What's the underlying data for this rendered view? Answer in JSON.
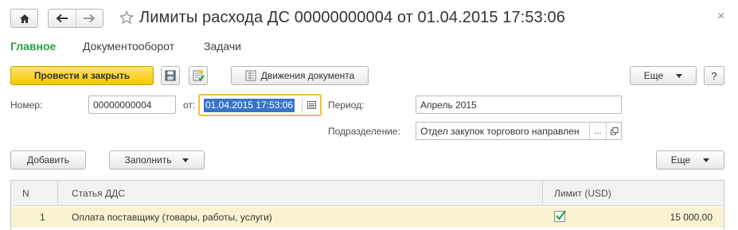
{
  "window": {
    "title": "Лимиты расхода ДС 00000000004 от 01.04.2015 17:53:06",
    "close_symbol": "×"
  },
  "tabs": [
    {
      "label": "Главное",
      "active": true
    },
    {
      "label": "Документооборот",
      "active": false
    },
    {
      "label": "Задачи",
      "active": false
    }
  ],
  "toolbar": {
    "post_close_label": "Провести и закрыть",
    "movements_label": "Движения документа",
    "more_label": "Еще",
    "help_label": "?"
  },
  "form": {
    "number_label": "Номер:",
    "number_value": "00000000004",
    "date_label": "от:",
    "date_value": "01.04.2015 17:53:06",
    "period_label": "Период:",
    "period_value": "Апрель 2015",
    "division_label": "Подразделение:",
    "division_value": "Отдел закупок торгового направлен",
    "division_select": "..."
  },
  "table_toolbar": {
    "add_label": "Добавить",
    "fill_label": "Заполнить",
    "more_label": "Еще"
  },
  "table": {
    "columns": [
      "N",
      "Статья ДДС",
      "Лимит (USD)"
    ],
    "rows": [
      {
        "n": "1",
        "item": "Оплата поставщику (товары, работы, услуги)",
        "checked": true,
        "amount": "15 000,00"
      }
    ]
  },
  "colors": {
    "accent_green": "#2a9d48",
    "primary_yellow": "#f5c800",
    "focus_border": "#f1c232",
    "selection_blue": "#3874c8",
    "row_highlight": "#faf3d1"
  }
}
